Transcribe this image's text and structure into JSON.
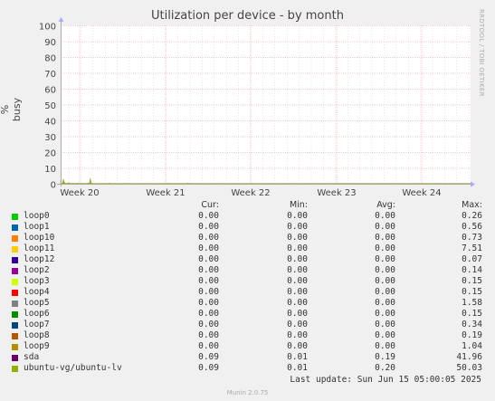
{
  "chart_data": {
    "type": "area",
    "title": "Utilization per device - by month",
    "ylabel": "% busy",
    "ylim": [
      0,
      100
    ],
    "yticks": [
      0,
      10,
      20,
      30,
      40,
      50,
      60,
      70,
      80,
      90,
      100
    ],
    "xticks": [
      "Week 20",
      "Week 21",
      "Week 22",
      "Week 23",
      "Week 24"
    ],
    "grid": true,
    "series": [
      {
        "name": "ubuntu-vg/ubuntu-lv",
        "color": "#9fa41b",
        "values": [
          2,
          0.5,
          0.3,
          3,
          1,
          0.3,
          0.2,
          0.5,
          0.3,
          0.8,
          0.3,
          0.2,
          0.3,
          0.2,
          0.4,
          0.2,
          0.3,
          0.2,
          0.5,
          0.3,
          0.2,
          0.3,
          0.2,
          0.4,
          0.2,
          0.3,
          0.2,
          0.3,
          0.2,
          0.3,
          0.5,
          0.2,
          3.5,
          0.5,
          0.2,
          0.3,
          0.2,
          0.2,
          0.3,
          0.2,
          0.2,
          0.3,
          0.2,
          0.2,
          0.3,
          0.2,
          0.2,
          0.3,
          0.2,
          0.2,
          0.3,
          0.2,
          0.2,
          0.5,
          0.2,
          0.2,
          0.3,
          0.2,
          0.2,
          0.3,
          0.2,
          0.2,
          0.3,
          0.2,
          0.2,
          0.3,
          0.2,
          0.2,
          0.3,
          0.2,
          0.2,
          0.4,
          0.2,
          0.2,
          0.3,
          0.2,
          0.2,
          0.3,
          0.2,
          0.2,
          0.3,
          0.2,
          0.2,
          0.3,
          0.2,
          0.2,
          0.3,
          0.2,
          0.2,
          0.3,
          0.2,
          0.2,
          0.3,
          0.2,
          0.2,
          0.3,
          0.2,
          0.2,
          0.3,
          0.2,
          0.2,
          0.3,
          0.2,
          0.2,
          0.3,
          0.2,
          0.2,
          0.3,
          0.2,
          0.2,
          0.3,
          0.2,
          0.2,
          0.3,
          0.2,
          0.2,
          0.5,
          0.2,
          0.2,
          0.3,
          0.2,
          0.2,
          0.3,
          0.2,
          0.2,
          0.3,
          0.2,
          0.2,
          0.3,
          0.2,
          0.2,
          0.3,
          0.2,
          0.2,
          0.3,
          0.2,
          0.2,
          0.5,
          0.3,
          0.2,
          0.3,
          0.2,
          0.2,
          0.3,
          0.2,
          0.2,
          0.3,
          0.2,
          0.2,
          0.3,
          0.2,
          0.2,
          0.3,
          0.2,
          0.2,
          0.3,
          0.2,
          0.2,
          0.3,
          0.2,
          0.2,
          0.3,
          0.2,
          0.2,
          0.3,
          0.2,
          0.2,
          0.3,
          0.2,
          0.2,
          0.3,
          0.2,
          0.2,
          0.3,
          0.2,
          0.2,
          0.3,
          0.2,
          0.2,
          0.3,
          0.2,
          0.2,
          0.3,
          0.2,
          0.2,
          0.3,
          0.2,
          0.2,
          0.3,
          0.2,
          0.2,
          0.3,
          0.2,
          0.2,
          0.3,
          0.2,
          0.2,
          0.3,
          0.2,
          0.2,
          0.3,
          0.2,
          0.2,
          0.3,
          0.2,
          0.2,
          0.3,
          0.2,
          0.2,
          0.3,
          0.2,
          0.2,
          0.3,
          0.2,
          0.2,
          0.3,
          0.2,
          0.2,
          0.3,
          0.2,
          0.2,
          0.3,
          0.2,
          0.2,
          0.3,
          0.2,
          0.2,
          0.3,
          0.2,
          0.2,
          0.3,
          0.2,
          0.2,
          0.3,
          0.2,
          0.2,
          0.3,
          0.2,
          0.2,
          0.3,
          0.2,
          0.2,
          0.3,
          0.2,
          0.2,
          0.3,
          0.2,
          0.2,
          0.3,
          0.2,
          0.2,
          0.3,
          0.2,
          0.2,
          0.3,
          0.2,
          0.2,
          0.3,
          0.2,
          0.2,
          0.3,
          0.2,
          0.2,
          0.3,
          0.2,
          0.2,
          0.3,
          0.2,
          0.2,
          0.3,
          0.2,
          0.2,
          0.3,
          0.2,
          0.2,
          0.3,
          0.2,
          0.2,
          0.3,
          0.2,
          0.2,
          0.3,
          0.2,
          0.2,
          0.3,
          0.2,
          0.2,
          0.3,
          0.2,
          0.2,
          0.3,
          0.2,
          0.2,
          0.3,
          0.2,
          0.2,
          0.3,
          0.2,
          0.2,
          0.3,
          0.2,
          0.2,
          0.3,
          0.2,
          0.2,
          0.3,
          0.2,
          0.2,
          0.3,
          0.2,
          0.2,
          0.3,
          0.2,
          0.2,
          0.3,
          0.2,
          0.2,
          0.3,
          0.2,
          0.2,
          0.3,
          0.2,
          0.2,
          0.3,
          0.2,
          0.2,
          0.3,
          0.2,
          0.2,
          0.3,
          0.2,
          0.2,
          0.3,
          0.2,
          0.2,
          0.3,
          0.2,
          0.2,
          0.3,
          0.2,
          0.2,
          0.3,
          0.2,
          0.2,
          0.3,
          0.2,
          0.2,
          0.3,
          0.2,
          0.2,
          0.3,
          0.2,
          0.2,
          0.3,
          0.2,
          0.2,
          0.3,
          0.2,
          0.2,
          0.3,
          0.2,
          0.2,
          0.3,
          0.2,
          0.2,
          0.3,
          0.2,
          0.2,
          0.3,
          0.2,
          0.2,
          0.3,
          0.2,
          0.2,
          0.3,
          0.2,
          0.2,
          0.3,
          0.2,
          0.2,
          0.3,
          0.2,
          0.2,
          0.3,
          0.2,
          0.2,
          0.3,
          0.2,
          0.2,
          0.3,
          0.2,
          0.2,
          0.3,
          0.2,
          0.2,
          0.3,
          0.2,
          0.2,
          0.3,
          0.2,
          0.2,
          0.3,
          0.2,
          0.2,
          0.3,
          0.2,
          0.2,
          0.3,
          0.2,
          0.2,
          0.3,
          0.2,
          0.2,
          0.3,
          0.2,
          0.2,
          0.3,
          0.2,
          0.2,
          0.3,
          0.2,
          0.2,
          0.3,
          0.2,
          0.2,
          0.3,
          0.2,
          0.2,
          0.3,
          0.2,
          0.2,
          0.3,
          0.2,
          0.2,
          0.3,
          0.2,
          0.2,
          0.3,
          0.2,
          0.2,
          0.3,
          0.2,
          0.2
        ]
      }
    ],
    "legend_headers": {
      "cur": "Cur:",
      "min": "Min:",
      "avg": "Avg:",
      "max": "Max:"
    },
    "legend": [
      {
        "name": "loop0",
        "color": "#00cc00",
        "cur": "0.00",
        "min": "0.00",
        "avg": "0.00",
        "max": "0.26"
      },
      {
        "name": "loop1",
        "color": "#0066b3",
        "cur": "0.00",
        "min": "0.00",
        "avg": "0.00",
        "max": "0.56"
      },
      {
        "name": "loop10",
        "color": "#ff8000",
        "cur": "0.00",
        "min": "0.00",
        "avg": "0.00",
        "max": "0.73"
      },
      {
        "name": "loop11",
        "color": "#ffcc00",
        "cur": "0.00",
        "min": "0.00",
        "avg": "0.00",
        "max": "7.51"
      },
      {
        "name": "loop12",
        "color": "#330099",
        "cur": "0.00",
        "min": "0.00",
        "avg": "0.00",
        "max": "0.07"
      },
      {
        "name": "loop2",
        "color": "#990099",
        "cur": "0.00",
        "min": "0.00",
        "avg": "0.00",
        "max": "0.14"
      },
      {
        "name": "loop3",
        "color": "#ccff00",
        "cur": "0.00",
        "min": "0.00",
        "avg": "0.00",
        "max": "0.15"
      },
      {
        "name": "loop4",
        "color": "#ff0000",
        "cur": "0.00",
        "min": "0.00",
        "avg": "0.00",
        "max": "0.15"
      },
      {
        "name": "loop5",
        "color": "#808080",
        "cur": "0.00",
        "min": "0.00",
        "avg": "0.00",
        "max": "1.58"
      },
      {
        "name": "loop6",
        "color": "#008f00",
        "cur": "0.00",
        "min": "0.00",
        "avg": "0.00",
        "max": "0.15"
      },
      {
        "name": "loop7",
        "color": "#00487d",
        "cur": "0.00",
        "min": "0.00",
        "avg": "0.00",
        "max": "0.34"
      },
      {
        "name": "loop8",
        "color": "#b35a00",
        "cur": "0.00",
        "min": "0.00",
        "avg": "0.00",
        "max": "0.19"
      },
      {
        "name": "loop9",
        "color": "#b38f00",
        "cur": "0.00",
        "min": "0.00",
        "avg": "0.00",
        "max": "1.04"
      },
      {
        "name": "sda",
        "color": "#6b006b",
        "cur": "0.09",
        "min": "0.01",
        "avg": "0.19",
        "max": "41.96"
      },
      {
        "name": "ubuntu-vg/ubuntu-lv",
        "color": "#8fb300",
        "cur": "0.09",
        "min": "0.01",
        "avg": "0.20",
        "max": "50.03"
      }
    ]
  },
  "watermark": "RRDTOOL / TOBI OETIKER",
  "last_update": "Last update: Sun Jun 15 05:00:05 2025",
  "footer": "Munin 2.0.75"
}
